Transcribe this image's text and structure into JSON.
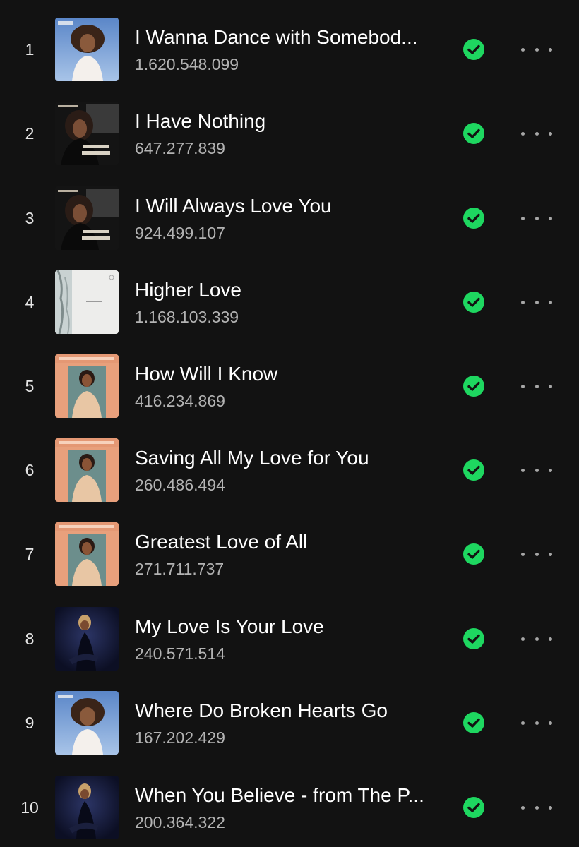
{
  "colors": {
    "background": "#121212",
    "title": "#ffffff",
    "subtext": "#b3b3b3",
    "accent": "#1ed760"
  },
  "icons": {
    "saved": "check-circle-icon",
    "more": "more-options-icon"
  },
  "tracks": [
    {
      "rank": "1",
      "title": "I Wanna Dance with Somebod...",
      "plays": "1.620.548.099",
      "cover": "whitney"
    },
    {
      "rank": "2",
      "title": "I Have Nothing",
      "plays": "647.277.839",
      "cover": "bodyguard"
    },
    {
      "rank": "3",
      "title": "I Will Always Love You",
      "plays": "924.499.107",
      "cover": "bodyguard"
    },
    {
      "rank": "4",
      "title": "Higher Love",
      "plays": "1.168.103.339",
      "cover": "higher-love"
    },
    {
      "rank": "5",
      "title": "How Will I Know",
      "plays": "416.234.869",
      "cover": "whitney-houston"
    },
    {
      "rank": "6",
      "title": "Saving All My Love for You",
      "plays": "260.486.494",
      "cover": "whitney-houston"
    },
    {
      "rank": "7",
      "title": "Greatest Love of All",
      "plays": "271.711.737",
      "cover": "whitney-houston"
    },
    {
      "rank": "8",
      "title": "My Love Is Your Love",
      "plays": "240.571.514",
      "cover": "my-love"
    },
    {
      "rank": "9",
      "title": "Where Do Broken Hearts Go",
      "plays": "167.202.429",
      "cover": "whitney"
    },
    {
      "rank": "10",
      "title": "When You Believe - from The P...",
      "plays": "200.364.322",
      "cover": "my-love"
    }
  ]
}
